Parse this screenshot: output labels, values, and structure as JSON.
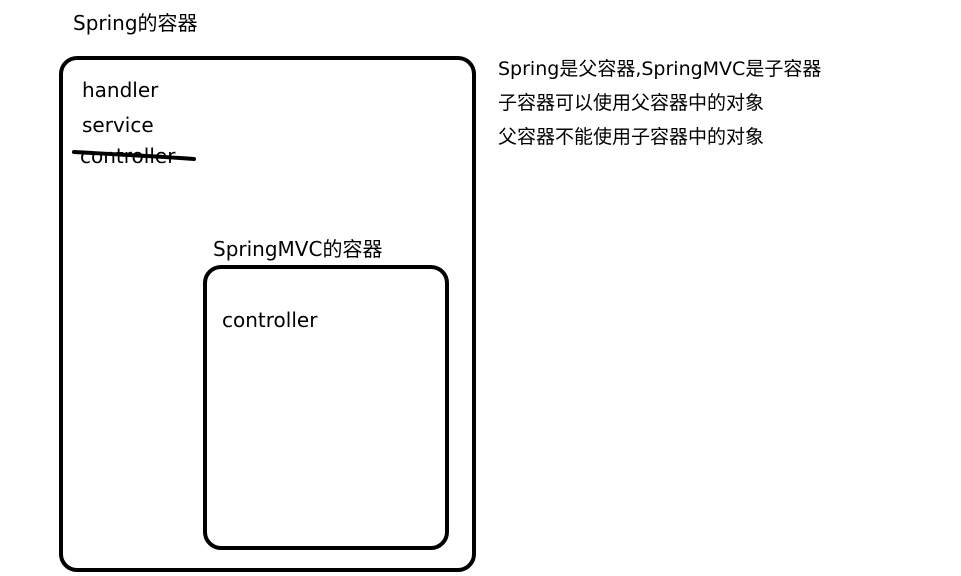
{
  "outer_container": {
    "title": "Spring的容器",
    "items": [
      "handler",
      "service",
      "controller"
    ],
    "crossed_out_item": "controller"
  },
  "inner_container": {
    "title": "SpringMVC的容器",
    "items": [
      "controller"
    ]
  },
  "notes": [
    "Spring是父容器,SpringMVC是子容器",
    "子容器可以使用父容器中的对象",
    "父容器不能使用子容器中的对象"
  ]
}
